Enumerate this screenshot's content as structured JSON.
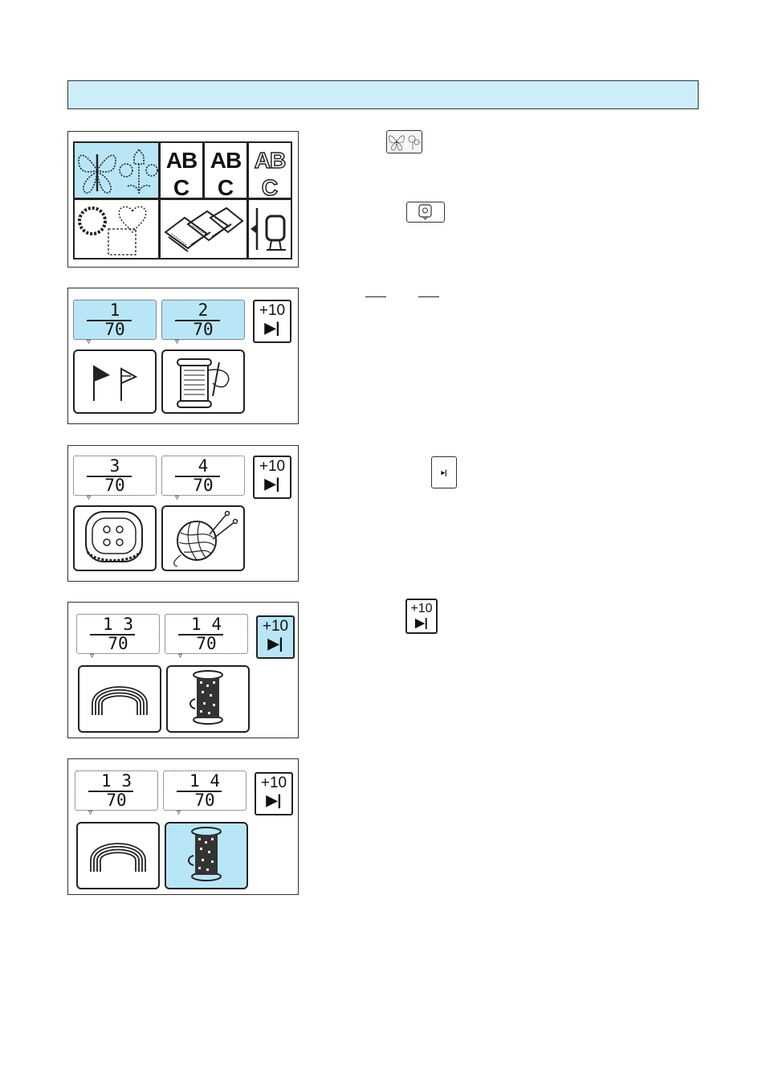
{
  "menu": {
    "cells": [
      {
        "type": "icon",
        "icon": "butterfly-flower-icon",
        "selected": true
      },
      {
        "type": "text",
        "top": "AB",
        "bottom": "C",
        "style": "bold",
        "selected": false
      },
      {
        "type": "text",
        "top": "AB",
        "bottom": "C",
        "style": "bold",
        "selected": false
      },
      {
        "type": "text",
        "top": "AB",
        "bottom": "C",
        "style": "outline",
        "selected": false
      },
      {
        "type": "icon",
        "icon": "frame-shapes-icon",
        "selected": false
      },
      {
        "type": "icon",
        "icon": "memory-pockets-icon",
        "selected": false
      },
      {
        "type": "icon",
        "icon": "hoop-back-icon",
        "selected": false
      }
    ]
  },
  "panels": [
    {
      "pages": [
        {
          "num": "1",
          "den": "70",
          "selected": true
        },
        {
          "num": "2",
          "den": "70",
          "selected": true
        }
      ],
      "patterns": [
        {
          "icon": "flags-icon",
          "selected": false
        },
        {
          "icon": "thread-spool-needle-icon",
          "selected": false
        }
      ],
      "plus10": {
        "label": "+10",
        "icon": "next-page-icon",
        "selected": false
      }
    },
    {
      "pages": [
        {
          "num": "3",
          "den": "70",
          "selected": false
        },
        {
          "num": "4",
          "den": "70",
          "selected": false
        }
      ],
      "patterns": [
        {
          "icon": "button-icon",
          "selected": false
        },
        {
          "icon": "yarn-ball-icon",
          "selected": false
        }
      ],
      "plus10": {
        "label": "+10",
        "icon": "next-page-icon",
        "selected": false
      }
    },
    {
      "pages": [
        {
          "num": "1 3",
          "den": "70",
          "selected": false
        },
        {
          "num": "1 4",
          "den": "70",
          "selected": false
        }
      ],
      "patterns": [
        {
          "icon": "arch-icon",
          "selected": false
        },
        {
          "icon": "spool-icon",
          "selected": false
        }
      ],
      "plus10": {
        "label": "+10",
        "icon": "next-page-icon",
        "selected": true
      }
    },
    {
      "pages": [
        {
          "num": "1 3",
          "den": "70",
          "selected": false
        },
        {
          "num": "1 4",
          "den": "70",
          "selected": false
        }
      ],
      "patterns": [
        {
          "icon": "arch-icon",
          "selected": false
        },
        {
          "icon": "spool-icon",
          "selected": true
        }
      ],
      "plus10": {
        "label": "+10",
        "icon": "next-page-icon",
        "selected": false
      }
    }
  ],
  "inline_icons": {
    "plus10_label": "+10",
    "small_next_label": "▸|"
  },
  "colors": {
    "accent": "#b9e6f7",
    "header": "#cdeef9",
    "stroke": "#222222"
  }
}
